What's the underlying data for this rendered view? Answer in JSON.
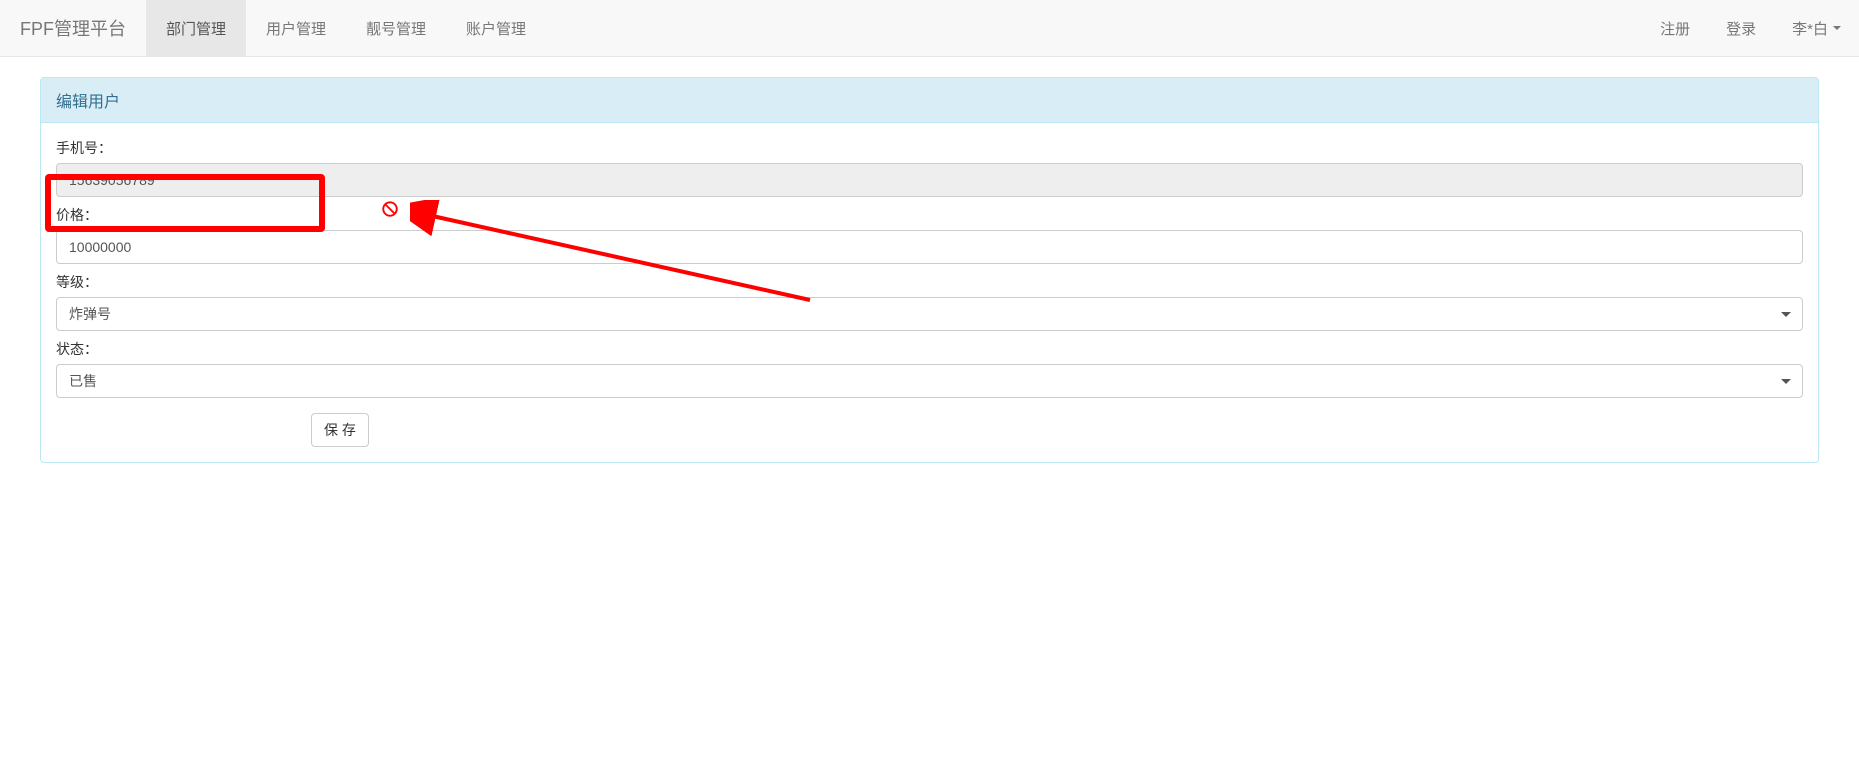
{
  "navbar": {
    "brand": "FPF管理平台",
    "items": [
      {
        "label": "部门管理",
        "active": true
      },
      {
        "label": "用户管理",
        "active": false
      },
      {
        "label": "靓号管理",
        "active": false
      },
      {
        "label": "账户管理",
        "active": false
      }
    ],
    "right_items": [
      {
        "label": "注册"
      },
      {
        "label": "登录"
      },
      {
        "label": "李*白",
        "dropdown": true
      }
    ]
  },
  "panel": {
    "title": "编辑用户"
  },
  "form": {
    "phone": {
      "label": "手机号：",
      "value": "15639056789"
    },
    "price": {
      "label": "价格：",
      "value": "10000000"
    },
    "level": {
      "label": "等级：",
      "selected": "炸弹号"
    },
    "status": {
      "label": "状态：",
      "selected": "已售"
    },
    "submit_label": "保 存"
  }
}
